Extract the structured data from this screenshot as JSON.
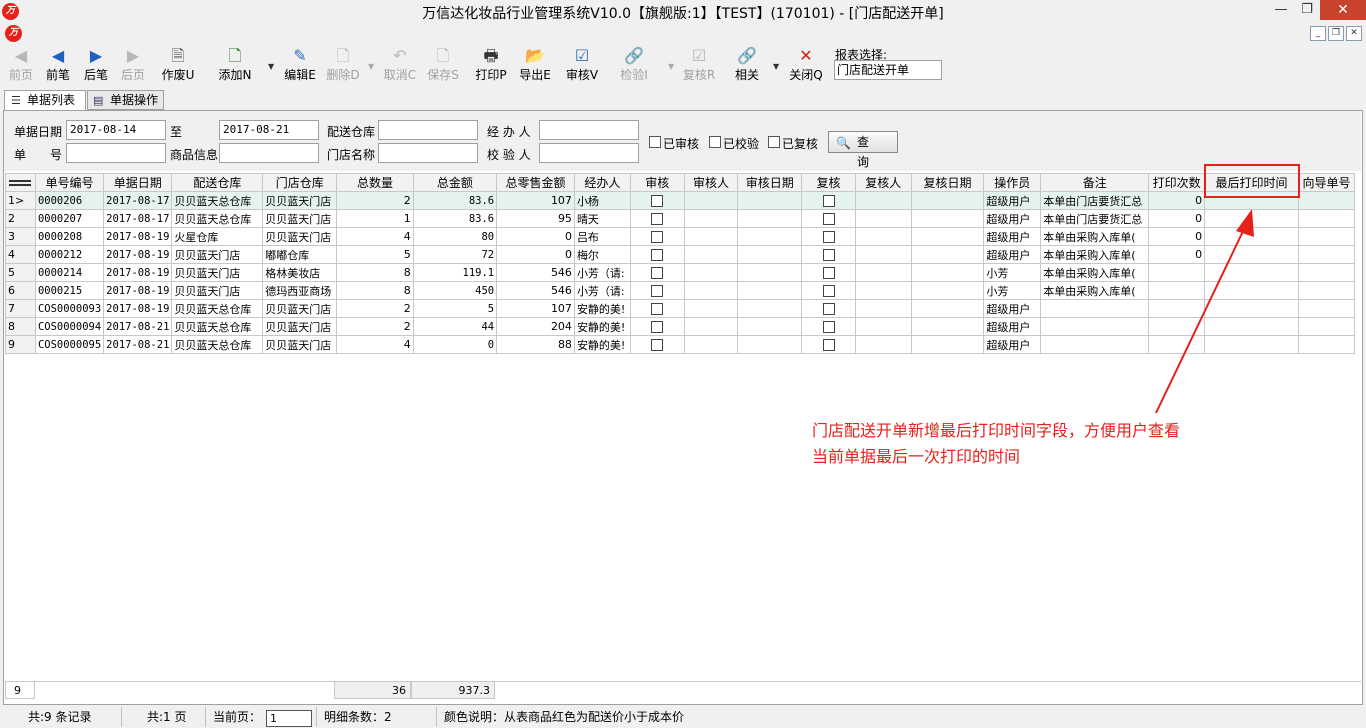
{
  "window": {
    "title": "万信达化妆品行业管理系统V10.0【旗舰版:1】【TEST】(170101) - [门店配送开单]",
    "logo_text": "万"
  },
  "toolbar": {
    "buttons": [
      {
        "label": "前页",
        "icon": "first-page-icon",
        "enabled": false
      },
      {
        "label": "前笔",
        "icon": "prev-record-icon",
        "enabled": true
      },
      {
        "label": "后笔",
        "icon": "next-record-icon",
        "enabled": true
      },
      {
        "label": "后页",
        "icon": "last-page-icon",
        "enabled": false
      },
      {
        "label": "作废U",
        "icon": "void-icon",
        "enabled": true
      },
      {
        "label": "添加N",
        "icon": "add-icon",
        "enabled": true
      },
      {
        "label": "编辑E",
        "icon": "edit-icon",
        "enabled": true
      },
      {
        "label": "删除D",
        "icon": "delete-icon",
        "enabled": false
      },
      {
        "label": "取消C",
        "icon": "undo-icon",
        "enabled": false
      },
      {
        "label": "保存S",
        "icon": "save-icon",
        "enabled": false
      },
      {
        "label": "打印P",
        "icon": "print-icon",
        "enabled": true
      },
      {
        "label": "导出E",
        "icon": "export-icon",
        "enabled": true
      },
      {
        "label": "审核V",
        "icon": "approve-icon",
        "enabled": true
      },
      {
        "label": "检验I",
        "icon": "link-icon",
        "enabled": false
      },
      {
        "label": "复核R",
        "icon": "recheck-icon",
        "enabled": false
      },
      {
        "label": "相关",
        "icon": "related-icon",
        "enabled": true
      },
      {
        "label": "关闭Q",
        "icon": "close-x-icon",
        "enabled": true
      }
    ],
    "report_select_label": "报表选择:",
    "report_select_value": "门店配送开单"
  },
  "tabs": [
    {
      "label": "单据列表",
      "active": true
    },
    {
      "label": "单据操作",
      "active": false
    }
  ],
  "filter": {
    "date_label": "单据日期",
    "date_from": "2017-08-14",
    "to_label": "至",
    "date_to": "2017-08-21",
    "warehouse_label": "配送仓库",
    "warehouse_value": "",
    "handler_label": "经 办 人",
    "handler_value": "",
    "docno_label": "单　　号",
    "docno_value": "",
    "product_label": "商品信息",
    "product_value": "",
    "store_label": "门店名称",
    "store_value": "",
    "inspector_label": "校 验 人",
    "inspector_value": "",
    "cb_approved": "已审核",
    "cb_verified": "已校验",
    "cb_rechecked": "已复核",
    "query_button": "查 询"
  },
  "grid": {
    "columns": [
      "单号编号",
      "单据日期",
      "配送仓库",
      "门店仓库",
      "总数量",
      "总金额",
      "总零售金额",
      "经办人",
      "审核",
      "审核人",
      "审核日期",
      "复核",
      "复核人",
      "复核日期",
      "操作员",
      "备注",
      "打印次数",
      "最后打印时间",
      "向导单号"
    ],
    "rows": [
      {
        "ind": "1>",
        "no": "0000206",
        "date": "2017-08-17",
        "wh": "贝贝蓝天总仓库",
        "store": "贝贝蓝天门店",
        "qty": "2",
        "amt": "83.6",
        "retail": "107",
        "handler": "小杨",
        "op": "超级用户",
        "remark": "本单由门店要货汇总",
        "prints": "0"
      },
      {
        "ind": "2",
        "no": "0000207",
        "date": "2017-08-17",
        "wh": "贝贝蓝天总仓库",
        "store": "贝贝蓝天门店",
        "qty": "1",
        "amt": "83.6",
        "retail": "95",
        "handler": "晴天",
        "op": "超级用户",
        "remark": "本单由门店要货汇总",
        "prints": "0"
      },
      {
        "ind": "3",
        "no": "0000208",
        "date": "2017-08-19",
        "wh": "火星仓库",
        "store": "贝贝蓝天门店",
        "qty": "4",
        "amt": "80",
        "retail": "0",
        "handler": "吕布",
        "op": "超级用户",
        "remark": "本单由采购入库单(",
        "prints": "0"
      },
      {
        "ind": "4",
        "no": "0000212",
        "date": "2017-08-19",
        "wh": "贝贝蓝天门店",
        "store": "嘟嘟仓库",
        "qty": "5",
        "amt": "72",
        "retail": "0",
        "handler": "梅尔",
        "op": "超级用户",
        "remark": "本单由采购入库单(",
        "prints": "0"
      },
      {
        "ind": "5",
        "no": "0000214",
        "date": "2017-08-19",
        "wh": "贝贝蓝天门店",
        "store": "格林美妆店",
        "qty": "8",
        "amt": "119.1",
        "retail": "546",
        "handler": "小芳（请:",
        "op": "小芳",
        "remark": "本单由采购入库单(",
        "prints": ""
      },
      {
        "ind": "6",
        "no": "0000215",
        "date": "2017-08-19",
        "wh": "贝贝蓝天门店",
        "store": "德玛西亚商场",
        "qty": "8",
        "amt": "450",
        "retail": "546",
        "handler": "小芳（请:",
        "op": "小芳",
        "remark": "本单由采购入库单(",
        "prints": ""
      },
      {
        "ind": "7",
        "no": "COS0000093",
        "date": "2017-08-19",
        "wh": "贝贝蓝天总仓库",
        "store": "贝贝蓝天门店",
        "qty": "2",
        "amt": "5",
        "retail": "107",
        "handler": "安静的美!",
        "op": "超级用户",
        "remark": "",
        "prints": ""
      },
      {
        "ind": "8",
        "no": "COS0000094",
        "date": "2017-08-21",
        "wh": "贝贝蓝天总仓库",
        "store": "贝贝蓝天门店",
        "qty": "2",
        "amt": "44",
        "retail": "204",
        "handler": "安静的美!",
        "op": "超级用户",
        "remark": "",
        "prints": ""
      },
      {
        "ind": "9",
        "no": "COS0000095",
        "date": "2017-08-21",
        "wh": "贝贝蓝天总仓库",
        "store": "贝贝蓝天门店",
        "qty": "4",
        "amt": "0",
        "retail": "88",
        "handler": "安静的美!",
        "op": "超级用户",
        "remark": "",
        "prints": ""
      }
    ],
    "footer_count": "9",
    "footer_qty": "36",
    "footer_amt": "937.3"
  },
  "annotation": {
    "line1": "门店配送开单新增最后打印时间字段，方便用户查看",
    "line2": "当前单据最后一次打印的时间",
    "color": "#e8201a"
  },
  "status": {
    "records": "共:9 条记录",
    "pages": "共:1 页",
    "current_page_label": "当前页：",
    "current_page": "1",
    "detail_count": "明细条数：2",
    "color_note": "颜色说明：从表商品红色为配送价小于成本价"
  }
}
